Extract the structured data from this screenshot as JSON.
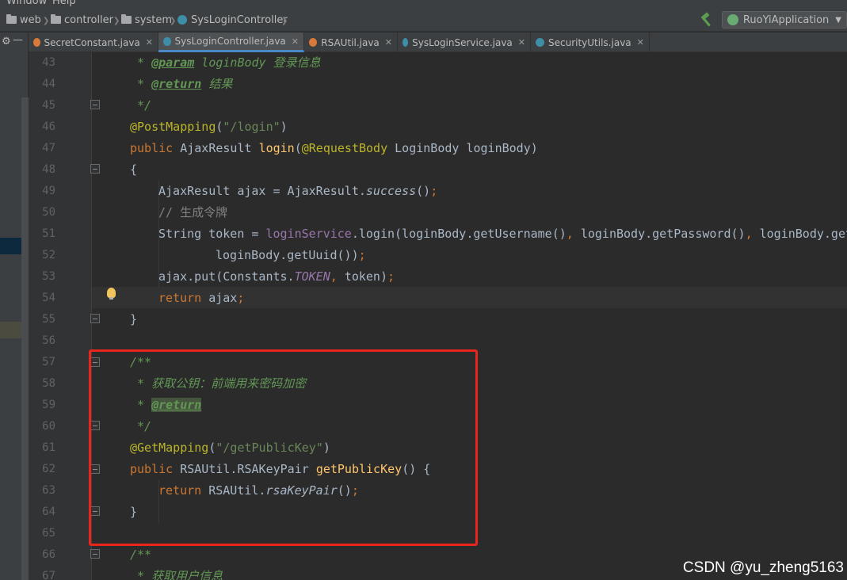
{
  "menu": {
    "items": [
      "Window",
      "Help"
    ]
  },
  "breadcrumb": {
    "items": [
      {
        "label": "web",
        "icon": "folder-icon"
      },
      {
        "label": "controller",
        "icon": "folder-icon"
      },
      {
        "label": "system",
        "icon": "folder-icon"
      },
      {
        "label": "SysLoginController",
        "icon": "class-icon"
      }
    ]
  },
  "run_config": {
    "label": "RuoYiApplication"
  },
  "tabs": [
    {
      "label": "SecretConstant.java",
      "active": false,
      "icon_color": "#d97a3a"
    },
    {
      "label": "SysLoginController.java",
      "active": true,
      "icon_color": "#3f8ea8"
    },
    {
      "label": "RSAUtil.java",
      "active": false,
      "icon_color": "#d97a3a"
    },
    {
      "label": "SysLoginService.java",
      "active": false,
      "icon_color": "#3f8ea8"
    },
    {
      "label": "SecurityUtils.java",
      "active": false,
      "icon_color": "#3f8ea8"
    }
  ],
  "editor": {
    "line_numbers": [
      "43",
      "44",
      "45",
      "46",
      "47",
      "48",
      "49",
      "50",
      "51",
      "52",
      "53",
      "54",
      "55",
      "56",
      "57",
      "58",
      "59",
      "60",
      "61",
      "62",
      "63",
      "64",
      "65",
      "66",
      "67"
    ],
    "code": {
      "l43": {
        "star": " * ",
        "tag": "@param",
        "name": " loginBody",
        "text": " 登录信息"
      },
      "l44": {
        "star": " * ",
        "tag": "@return",
        "text": " 结果"
      },
      "l45": {
        "text": " */"
      },
      "l46": {
        "ann": "@PostMapping",
        "open": "(",
        "str": "\"/login\"",
        "close": ")"
      },
      "l47": {
        "kw": "public ",
        "type": "AjaxResult ",
        "fn": "login",
        "open": "(",
        "ann": "@RequestBody ",
        "rest": "LoginBody loginBody)"
      },
      "l48": {
        "text": "{"
      },
      "l49": {
        "a": "AjaxResult ajax = AjaxResult.",
        "m": "success",
        "b": "()",
        "semi": ";"
      },
      "l50": {
        "text": "// 生成令牌"
      },
      "l51": {
        "a": "String token = ",
        "fld": "loginService",
        "b": ".login(loginBody.getUsername()",
        "c1": ", ",
        "d": "loginBody.getPassword()",
        "c2": ", ",
        "e": "loginBody.getC"
      },
      "l52": {
        "a": "loginBody.getUuid())",
        "semi": ";"
      },
      "l53": {
        "a": "ajax.put(Constants.",
        "const": "TOKEN",
        "comma": ", ",
        "b": "token)",
        "semi": ";"
      },
      "l54": {
        "kw": "return ",
        "a": "ajax",
        "semi": ";"
      },
      "l55": {
        "text": "}"
      },
      "l57": {
        "text": "/**"
      },
      "l58": {
        "text": " * 获取公钥：前端用来密码加密"
      },
      "l59": {
        "star": " * ",
        "tag": "@return"
      },
      "l60": {
        "text": " */"
      },
      "l61": {
        "ann": "@GetMapping",
        "open": "(",
        "str": "\"/getPublicKey\"",
        "close": ")"
      },
      "l62": {
        "kw": "public ",
        "type": "RSAUtil.RSAKeyPair ",
        "fn": "getPublicKey",
        "rest": "() {"
      },
      "l63": {
        "kw": "return ",
        "a": "RSAUtil.",
        "m": "rsaKeyPair",
        "b": "()",
        "semi": ";"
      },
      "l64": {
        "text": "}"
      },
      "l66": {
        "text": "/**"
      },
      "l67": {
        "text": " * 获取用户信息"
      }
    }
  },
  "watermark": "CSDN @yu_zheng5163"
}
